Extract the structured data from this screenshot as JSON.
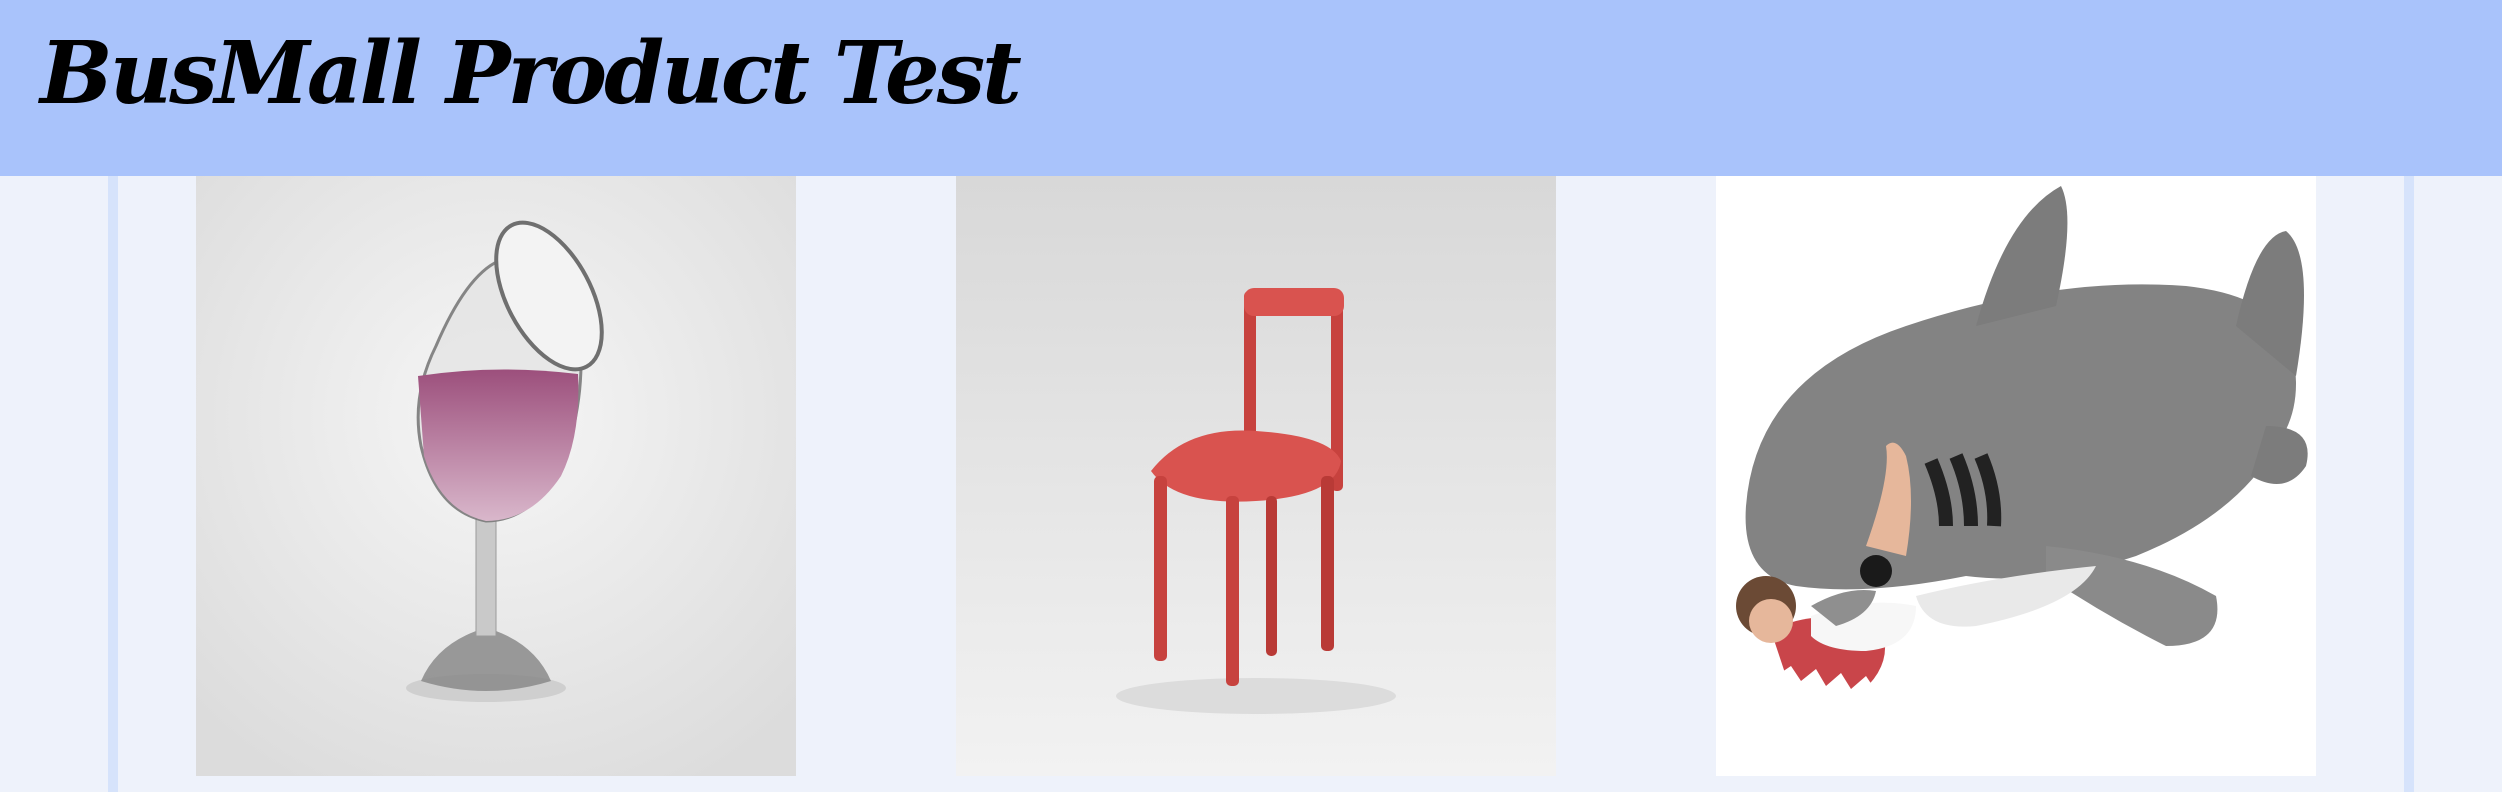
{
  "header": {
    "title": "BusMall Product Test",
    "background": "#a9c3fb"
  },
  "products": [
    {
      "name": "wine-glass",
      "icon": "wine-glass-image"
    },
    {
      "name": "chair",
      "icon": "chair-image"
    },
    {
      "name": "shark-sleeping-bag",
      "icon": "shark-image"
    }
  ],
  "colors": {
    "page_background": "#eef2fb",
    "side_border": "#d6e3fb",
    "chair_red": "#d9534f",
    "shark_gray": "#7f7f7f",
    "wine_pink": "#b5749a"
  }
}
